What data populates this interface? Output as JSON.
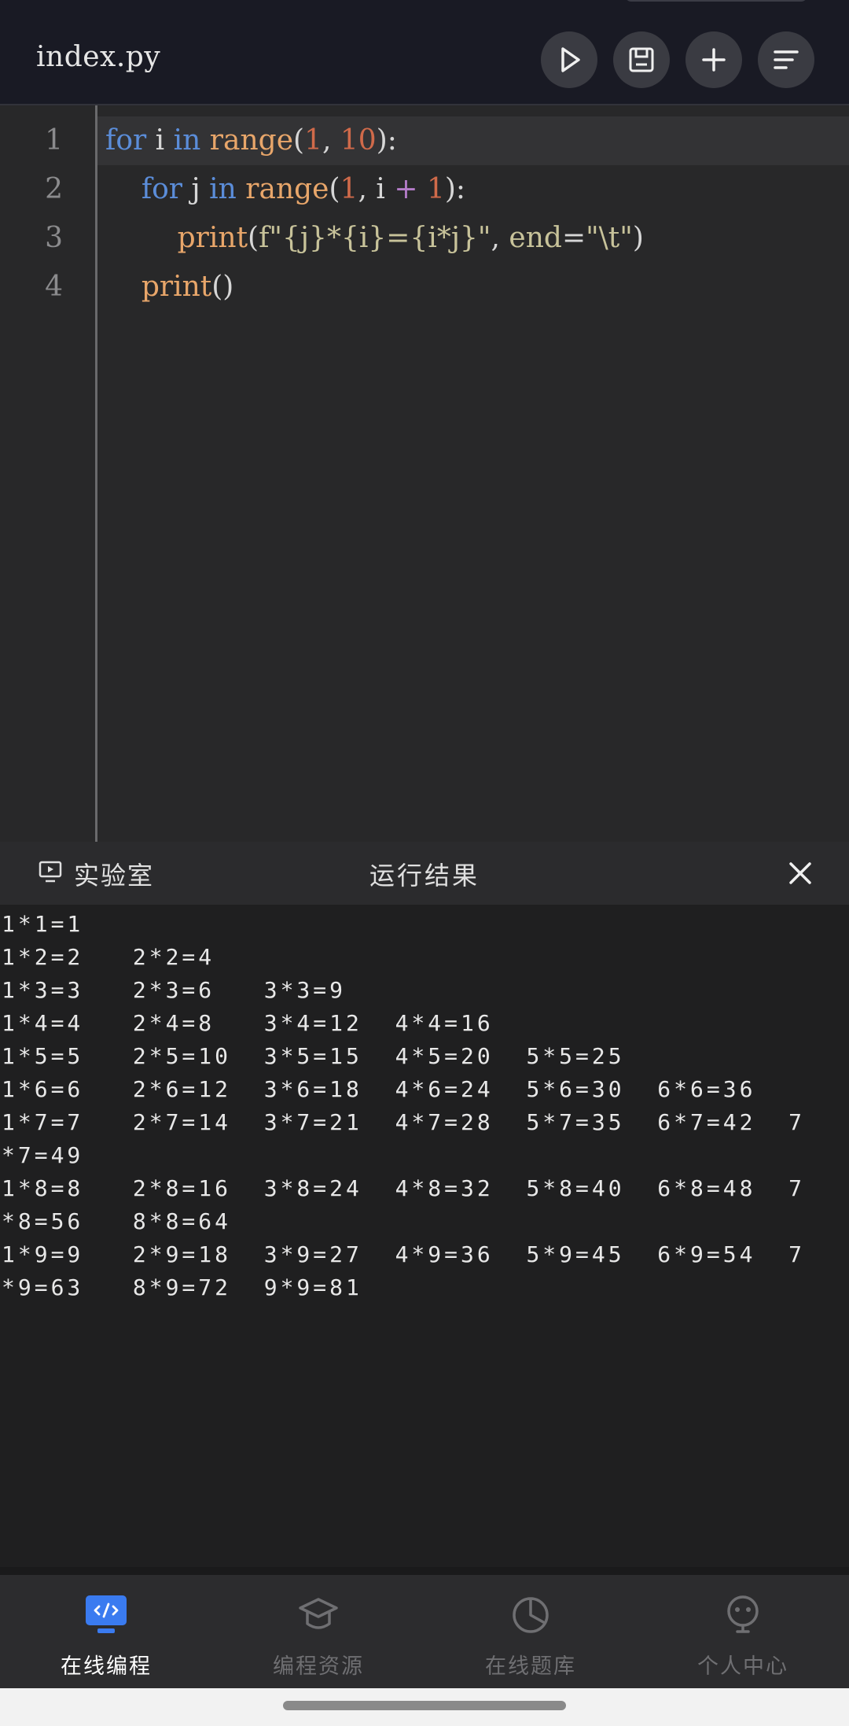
{
  "header": {
    "filename": "index.py",
    "buttons": [
      {
        "icon": "play-icon"
      },
      {
        "icon": "save-icon"
      },
      {
        "icon": "plus-icon"
      },
      {
        "icon": "menu-icon"
      }
    ]
  },
  "editor": {
    "line_numbers": [
      "1",
      "2",
      "3",
      "4"
    ],
    "code_lines": [
      "for i in range(1, 10):",
      "    for j in range(1, i + 1):",
      "        print(f\"{j}*{i}={i*j}\", end=\"\\t\")",
      "    print()"
    ]
  },
  "panel": {
    "lab_label": "实验室",
    "title": "运行结果",
    "close_icon": "close-icon"
  },
  "output_lines": [
    "1*1=1",
    "1*2=2   2*2=4",
    "1*3=3   2*3=6   3*3=9",
    "1*4=4   2*4=8   3*4=12  4*4=16",
    "1*5=5   2*5=10  3*5=15  4*5=20  5*5=25",
    "1*6=6   2*6=12  3*6=18  4*6=24  5*6=30  6*6=36",
    "1*7=7   2*7=14  3*7=21  4*7=28  5*7=35  6*7=42  7",
    "*7=49",
    "1*8=8   2*8=16  3*8=24  4*8=32  5*8=40  6*8=48  7",
    "*8=56   8*8=64",
    "1*9=9   2*9=18  3*9=27  4*9=36  5*9=45  6*9=54  7",
    "*9=63   8*9=72  9*9=81"
  ],
  "bottom_nav": [
    {
      "label": "在线编程",
      "icon": "code-monitor-icon",
      "active": true,
      "color": "#3a7bf0"
    },
    {
      "label": "编程资源",
      "icon": "graduation-cap-icon",
      "active": false
    },
    {
      "label": "在线题库",
      "icon": "pie-chart-icon",
      "active": false
    },
    {
      "label": "个人中心",
      "icon": "user-icon",
      "active": false
    }
  ]
}
